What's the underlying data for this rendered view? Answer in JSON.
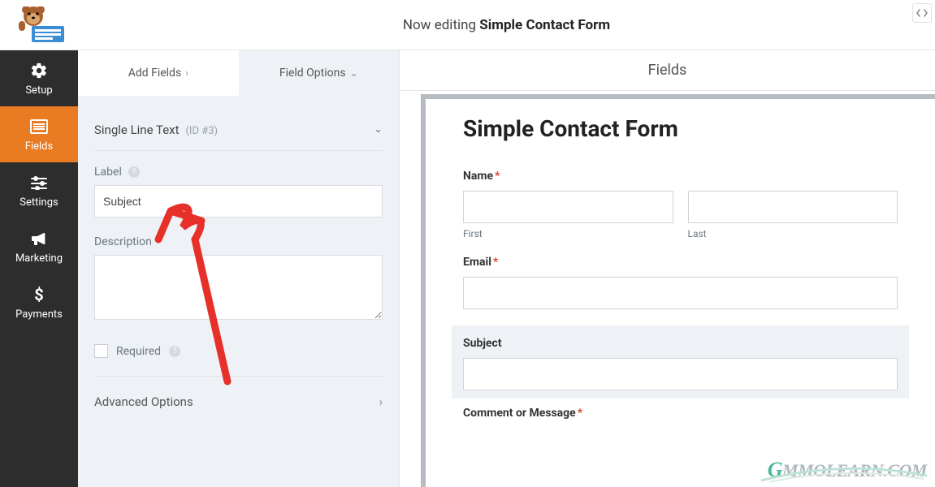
{
  "top": {
    "editing_prefix": "Now editing",
    "form_name": "Simple Contact Form"
  },
  "nav": {
    "setup": "Setup",
    "fields": "Fields",
    "settings": "Settings",
    "marketing": "Marketing",
    "payments": "Payments"
  },
  "tabs": {
    "add_fields": "Add Fields",
    "field_options": "Field Options"
  },
  "field_panel": {
    "type_title": "Single Line Text",
    "id_text": "(ID #3)",
    "label_label": "Label",
    "label_value": "Subject",
    "description_label": "Description",
    "description_value": "",
    "required_label": "Required",
    "advanced_label": "Advanced Options"
  },
  "preview": {
    "header": "Fields",
    "form_title": "Simple Contact Form",
    "name_label": "Name",
    "first_sub": "First",
    "last_sub": "Last",
    "email_label": "Email",
    "subject_label": "Subject",
    "comment_label": "Comment or Message"
  },
  "watermark": {
    "text_rest": "MMOLEARN.COM"
  }
}
